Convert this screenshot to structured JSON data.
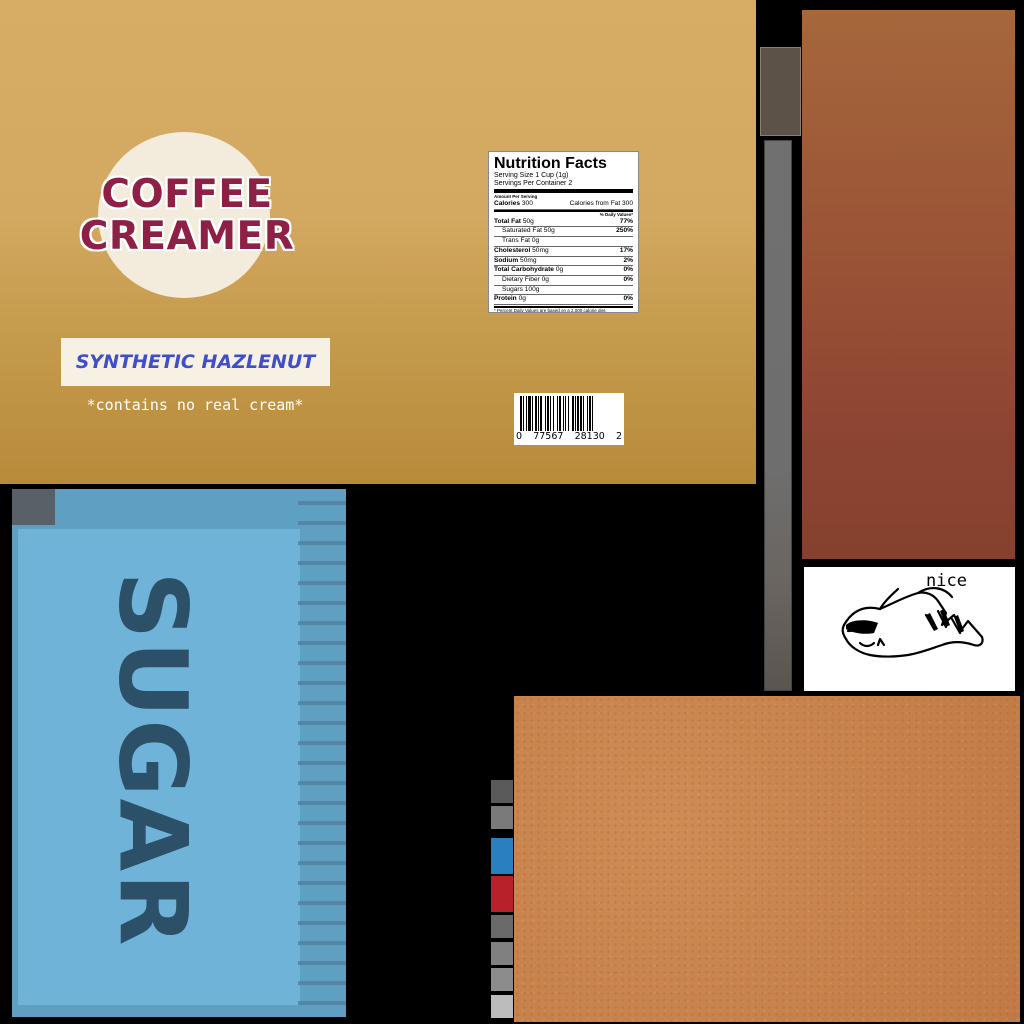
{
  "creamer_box": {
    "logo_line1": "COFFEE",
    "logo_line2": "CREAMER",
    "flavor": "SYNTHETIC HAZLENUT",
    "disclaimer": "*contains no real cream*",
    "colors": {
      "box": "#d3a860",
      "logo": "#8e1f45",
      "flavor_text": "#3f4fc9"
    }
  },
  "nutrition": {
    "title": "Nutrition Facts",
    "serving_size": "Serving Size 1 Cup (1g)",
    "servings_per_container": "Servings Per Container 2",
    "amount_per_serving": "Amount Per Serving",
    "calories_label": "Calories",
    "calories_value": "300",
    "calories_from_fat": "Calories from Fat 300",
    "daily_values_header": "% Daily Values*",
    "rows": [
      {
        "label": "Total Fat",
        "amount": "50g",
        "dv": "77%"
      },
      {
        "label": "Saturated Fat",
        "amount": "50g",
        "dv": "250%"
      },
      {
        "label": "Trans Fat",
        "amount": "0g",
        "dv": ""
      },
      {
        "label": "Cholesterol",
        "amount": "50mg",
        "dv": "17%"
      },
      {
        "label": "Sodium",
        "amount": "50mg",
        "dv": "2%"
      },
      {
        "label": "Total Carbohydrate",
        "amount": "0g",
        "dv": "0%"
      },
      {
        "label": "Dietary Fiber",
        "amount": "0g",
        "dv": "0%"
      },
      {
        "label": "Sugars",
        "amount": "100g",
        "dv": ""
      },
      {
        "label": "Protein",
        "amount": "0g",
        "dv": "0%"
      }
    ],
    "footnote": "* Percent Daily Values are based on a 2,000 calorie diet."
  },
  "barcode": {
    "digits": [
      "0",
      "77567",
      "28130",
      "2"
    ]
  },
  "sugar_packet": {
    "word": "SUGAR",
    "colors": {
      "packet": "#6fb3d9",
      "text": "#2c5068"
    }
  },
  "nice_sticker": {
    "text": "nice"
  },
  "swatches": [
    {
      "name": "gray-dark",
      "color": "#5a5a5a"
    },
    {
      "name": "gray-mid",
      "color": "#7a7a7a"
    },
    {
      "name": "blue",
      "color": "#2a7fc0"
    },
    {
      "name": "red",
      "color": "#b8202a"
    },
    {
      "name": "gray-2",
      "color": "#6a6a6a"
    },
    {
      "name": "gray-3",
      "color": "#808080"
    },
    {
      "name": "gray-4",
      "color": "#8c8c8c"
    },
    {
      "name": "gray-light",
      "color": "#bcbcbc"
    }
  ]
}
